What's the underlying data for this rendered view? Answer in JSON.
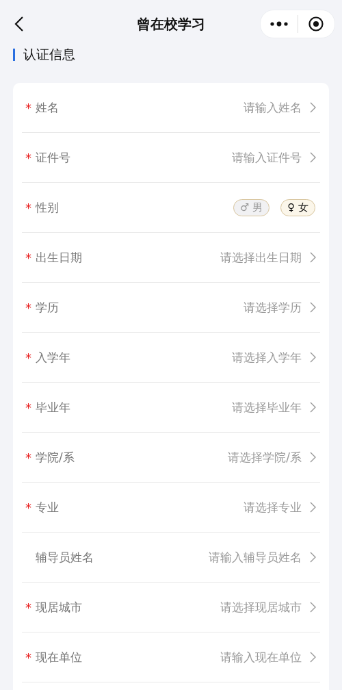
{
  "nav": {
    "title": "曾在校学习"
  },
  "section": {
    "title": "认证信息"
  },
  "required_mark": "*",
  "rows": [
    {
      "kind": "select",
      "label": "姓名",
      "required": true,
      "placeholder": "请输入姓名"
    },
    {
      "kind": "select",
      "label": "证件号",
      "required": true,
      "placeholder": "请输入证件号"
    },
    {
      "kind": "gender",
      "label": "性别",
      "required": true,
      "options": [
        {
          "symbol": "♂",
          "label": "男",
          "selected": false
        },
        {
          "symbol": "♀",
          "label": "女",
          "selected": true
        }
      ]
    },
    {
      "kind": "select",
      "label": "出生日期",
      "required": true,
      "placeholder": "请选择出生日期"
    },
    {
      "kind": "select",
      "label": "学历",
      "required": true,
      "placeholder": "请选择学历"
    },
    {
      "kind": "select",
      "label": "入学年",
      "required": true,
      "placeholder": "请选择入学年"
    },
    {
      "kind": "select",
      "label": "毕业年",
      "required": true,
      "placeholder": "请选择毕业年"
    },
    {
      "kind": "select",
      "label": "学院/系",
      "required": true,
      "placeholder": "请选择学院/系"
    },
    {
      "kind": "select",
      "label": "专业",
      "required": true,
      "placeholder": "请选择专业"
    },
    {
      "kind": "select",
      "label": "辅导员姓名",
      "required": false,
      "placeholder": "请输入辅导员姓名"
    },
    {
      "kind": "select",
      "label": "现居城市",
      "required": true,
      "placeholder": "请选择现居城市"
    },
    {
      "kind": "select",
      "label": "现在单位",
      "required": true,
      "placeholder": "请输入现在单位"
    }
  ]
}
